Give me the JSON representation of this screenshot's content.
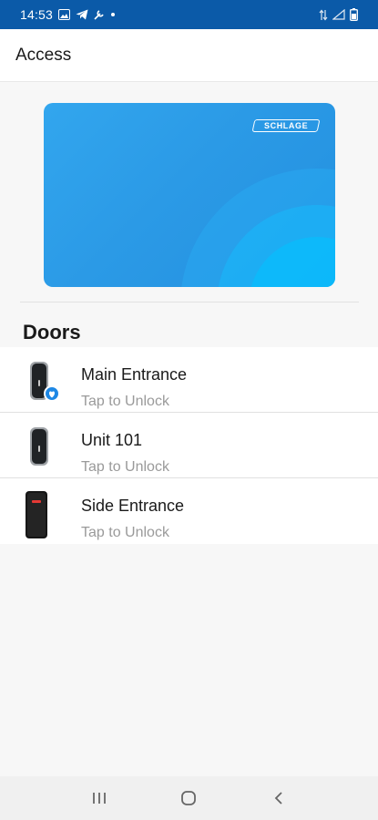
{
  "status_bar": {
    "time": "14:53",
    "icons_left": [
      "image-icon",
      "telegram-icon",
      "tool-icon",
      "dot-icon"
    ],
    "icons_right": [
      "data-arrows-icon",
      "signal-icon",
      "battery-icon"
    ]
  },
  "app_bar": {
    "title": "Access"
  },
  "card": {
    "brand": "SCHLAGE"
  },
  "section": {
    "title": "Doors"
  },
  "doors": [
    {
      "name": "Main Entrance",
      "action": "Tap to Unlock",
      "icon": "reader-lock-icon",
      "favorite": true
    },
    {
      "name": "Unit 101",
      "action": "Tap to Unlock",
      "icon": "reader-lock-icon",
      "favorite": false
    },
    {
      "name": "Side Entrance",
      "action": "Tap to Unlock",
      "icon": "red-reader-icon",
      "favorite": false
    }
  ],
  "nav_bar": {
    "buttons": [
      "recent-apps-icon",
      "home-icon",
      "back-icon"
    ]
  },
  "colors": {
    "status_bar": "#0b5aa8",
    "card": "#2b9ae6",
    "favorite_badge": "#1e88e5"
  }
}
